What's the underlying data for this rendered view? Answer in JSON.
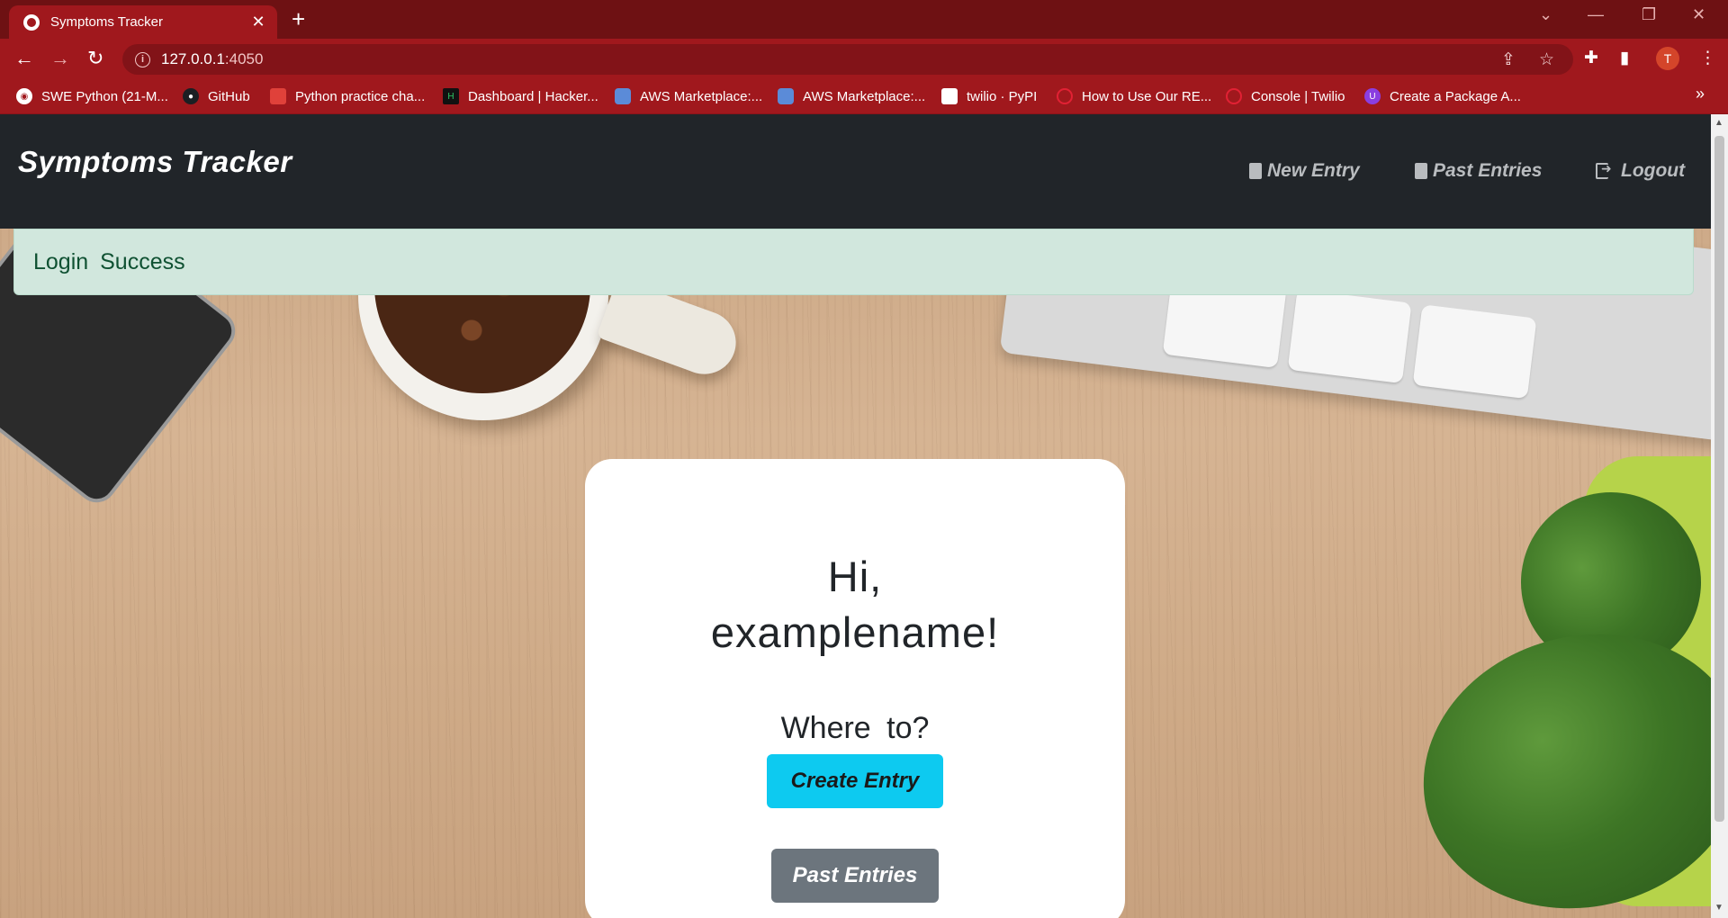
{
  "browser": {
    "tab_title": "Symptoms Tracker",
    "tab_close": "✕",
    "new_tab": "+",
    "url_host": "127.0.0.1",
    "url_port": ":4050",
    "profile_initial": "T",
    "window_controls": [
      "⌄",
      "—",
      "❐",
      "✕"
    ],
    "accent_color": "#a0181d"
  },
  "bookmarks": [
    {
      "label": "SWE Python (21-M...",
      "icon": "globe-icon",
      "color": "#ffffff"
    },
    {
      "label": "GitHub",
      "icon": "github-icon",
      "color": "#1b1f23"
    },
    {
      "label": "Python practice cha...",
      "icon": "python-icon",
      "color": "#e0413a"
    },
    {
      "label": "Dashboard | Hacker...",
      "icon": "hackerrank-icon",
      "color": "#111111"
    },
    {
      "label": "AWS Marketplace:...",
      "icon": "aws-icon",
      "color": "#5b8bd8"
    },
    {
      "label": "AWS Marketplace:...",
      "icon": "aws-icon",
      "color": "#5b8bd8"
    },
    {
      "label": "twilio · PyPI",
      "icon": "pypi-icon",
      "color": "#ffffff"
    },
    {
      "label": "How to Use Our RE...",
      "icon": "twilio-icon",
      "color": "#e22134"
    },
    {
      "label": "Console | Twilio",
      "icon": "twilio-icon",
      "color": "#e22134"
    },
    {
      "label": "Create a Package A...",
      "icon": "package-icon",
      "color": "#8a3ee0"
    }
  ],
  "app": {
    "brand": "Symptoms Tracker",
    "nav": {
      "new_entry": "New Entry",
      "past_entries": "Past Entries",
      "logout": "Logout"
    },
    "alert": "Login Success",
    "card": {
      "greeting_line1": "Hi,",
      "greeting_line2": "examplename!",
      "prompt": "Where to?",
      "create_button": "Create Entry",
      "past_button": "Past Entries"
    },
    "colors": {
      "navbar": "#212529",
      "alert_bg": "#d1e7dd",
      "alert_text": "#0f5132",
      "create_button": "#0dcaf0",
      "past_button": "#6c757d"
    }
  }
}
